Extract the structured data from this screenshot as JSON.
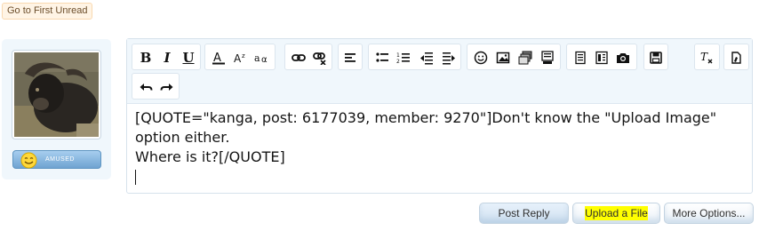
{
  "top": {
    "go_first_unread": "Go to First Unread"
  },
  "user": {
    "mood_label": "AMUSED"
  },
  "toolbar": {
    "icons": [
      "bold-icon",
      "italic-icon",
      "underline-icon",
      "font-color-icon",
      "font-size-icon",
      "font-family-icon",
      "link-icon",
      "unlink-icon",
      "align-icon",
      "bullet-list-icon",
      "numbered-list-icon",
      "outdent-icon",
      "indent-icon",
      "smilies-icon",
      "image-icon",
      "media-icon",
      "code-icon",
      "quote-icon",
      "spoiler-icon",
      "camera-icon",
      "save-draft-icon",
      "remove-format-icon",
      "toggle-bbcode-icon",
      "undo-icon",
      "redo-icon"
    ]
  },
  "editor": {
    "line1": "[QUOTE=\"kanga, post: 6177039, member: 9270\"]Don't know the \"Upload Image\"",
    "line2": "option either.",
    "line3": "Where is it?[/QUOTE]"
  },
  "actions": {
    "post_reply": "Post Reply",
    "upload_file": "Upload a File",
    "more_options": "More Options..."
  },
  "colors": {
    "highlight": "#ffff00",
    "panel_bg": "#f0f7fc",
    "accent_blue": "#6fa3d1"
  }
}
